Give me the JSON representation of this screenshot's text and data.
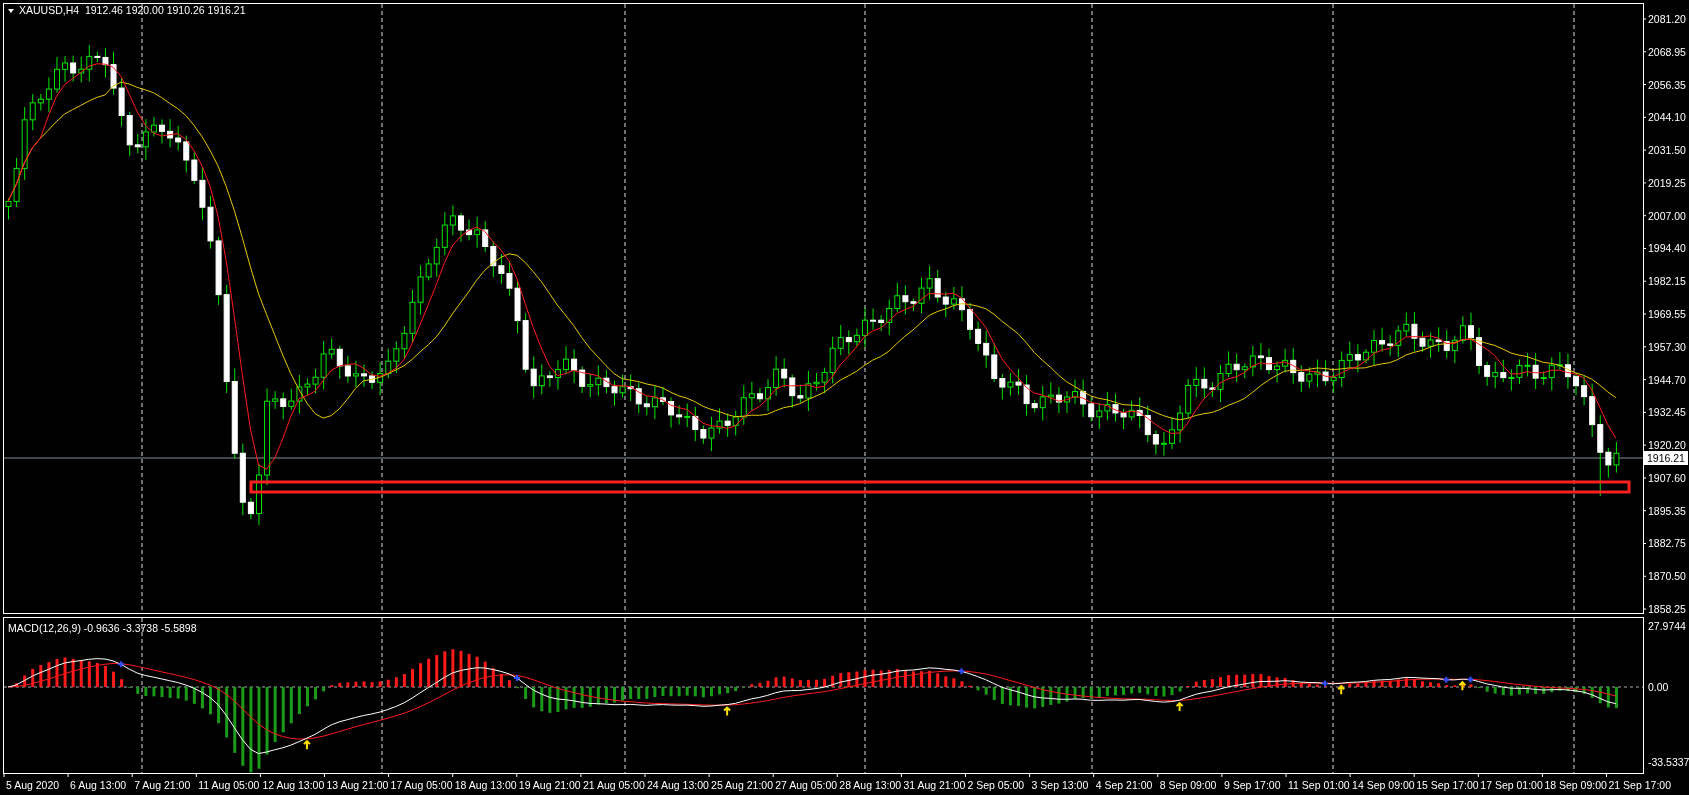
{
  "chart": {
    "symbol": "XAUUSD,H4",
    "ohlc": [
      "1912.46",
      "1920.00",
      "1910.26",
      "1916.21"
    ],
    "price_ticks": [
      "2081.20",
      "2068.95",
      "2056.35",
      "2044.10",
      "2031.50",
      "2019.25",
      "2007.00",
      "1994.40",
      "1982.15",
      "1969.55",
      "1957.30",
      "1944.70",
      "1932.45",
      "1920.20",
      "1907.60",
      "1895.35",
      "1882.75",
      "1870.50",
      "1858.25"
    ],
    "current_price": "1916.21",
    "time_labels": [
      "5 Aug 2020",
      "6 Aug 13:00",
      "7 Aug 21:00",
      "11 Aug 05:00",
      "12 Aug 13:00",
      "13 Aug 21:00",
      "17 Aug 05:00",
      "18 Aug 13:00",
      "19 Aug 21:00",
      "21 Aug 05:00",
      "24 Aug 13:00",
      "25 Aug 21:00",
      "27 Aug 05:00",
      "28 Aug 13:00",
      "31 Aug 21:00",
      "2 Sep 05:00",
      "3 Sep 13:00",
      "4 Sep 21:00",
      "8 Sep 09:00",
      "9 Sep 17:00",
      "11 Sep 01:00",
      "14 Sep 09:00",
      "15 Sep 17:00",
      "17 Sep 01:00",
      "18 Sep 09:00",
      "21 Sep 17:00"
    ]
  },
  "macd": {
    "label": "MACD(12,26,9) -0.9636 -3.3738 -5.5898",
    "ticks": [
      "27.9744",
      "0.00",
      "-33.5337"
    ]
  }
}
